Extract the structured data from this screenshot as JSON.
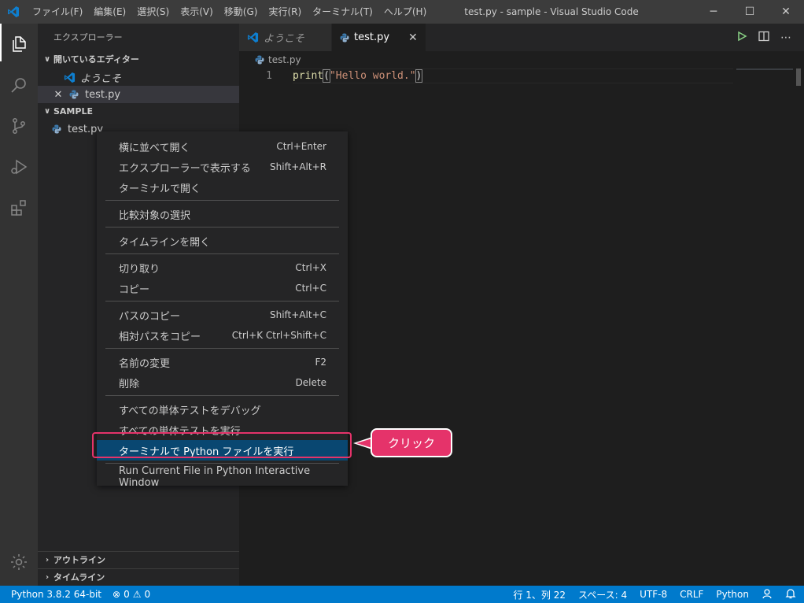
{
  "window": {
    "title": "test.py - sample - Visual Studio Code",
    "controls": {
      "minimize": "─",
      "maximize": "☐",
      "close": "✕"
    }
  },
  "menu": [
    "ファイル(F)",
    "編集(E)",
    "選択(S)",
    "表示(V)",
    "移動(G)",
    "実行(R)",
    "ターミナル(T)",
    "ヘルプ(H)"
  ],
  "sidebar": {
    "title": "エクスプローラー",
    "open_editors": {
      "header": "開いているエディター",
      "items": [
        {
          "label": "ようこそ",
          "icon": "vscode-icon"
        },
        {
          "label": "test.py",
          "icon": "python-icon",
          "close": "✕"
        }
      ]
    },
    "folder": {
      "header": "SAMPLE",
      "items": [
        {
          "label": "test.py",
          "icon": "python-icon"
        }
      ]
    },
    "outline_header": "アウトライン",
    "timeline_header": "タイムライン"
  },
  "tabs": [
    {
      "label": "ようこそ",
      "icon": "vscode-icon",
      "active": false
    },
    {
      "label": "test.py",
      "icon": "python-icon",
      "active": true,
      "close": "✕"
    }
  ],
  "breadcrumb": {
    "file": "test.py"
  },
  "editor": {
    "lines": [
      {
        "number": "1",
        "fn": "print",
        "open": "(",
        "str": "\"Hello world.\"",
        "close": ")"
      }
    ]
  },
  "context_menu": {
    "groups": [
      [
        {
          "label": "横に並べて開く",
          "shortcut": "Ctrl+Enter"
        },
        {
          "label": "エクスプローラーで表示する",
          "shortcut": "Shift+Alt+R"
        },
        {
          "label": "ターミナルで開く",
          "shortcut": ""
        }
      ],
      [
        {
          "label": "比較対象の選択",
          "shortcut": ""
        }
      ],
      [
        {
          "label": "タイムラインを開く",
          "shortcut": ""
        }
      ],
      [
        {
          "label": "切り取り",
          "shortcut": "Ctrl+X"
        },
        {
          "label": "コピー",
          "shortcut": "Ctrl+C"
        }
      ],
      [
        {
          "label": "パスのコピー",
          "shortcut": "Shift+Alt+C"
        },
        {
          "label": "相対パスをコピー",
          "shortcut": "Ctrl+K Ctrl+Shift+C"
        }
      ],
      [
        {
          "label": "名前の変更",
          "shortcut": "F2"
        },
        {
          "label": "削除",
          "shortcut": "Delete"
        }
      ],
      [
        {
          "label": "すべての単体テストをデバッグ",
          "shortcut": ""
        },
        {
          "label": "すべての単体テストを実行",
          "shortcut": ""
        },
        {
          "label": "ターミナルで Python ファイルを実行",
          "shortcut": "",
          "highlighted": true
        }
      ],
      [
        {
          "label": "Run Current File in Python Interactive Window",
          "shortcut": ""
        }
      ]
    ]
  },
  "callout": {
    "text": "クリック",
    "color": "#e5336a"
  },
  "statusbar": {
    "interpreter": "Python 3.8.2 64-bit",
    "errors": "0",
    "warnings": "0",
    "position": "行 1、列 22",
    "spaces": "スペース: 4",
    "encoding": "UTF-8",
    "eol": "CRLF",
    "language": "Python"
  },
  "colors": {
    "accent": "#007acc",
    "menu_highlight": "#094771",
    "callout": "#e5336a"
  }
}
